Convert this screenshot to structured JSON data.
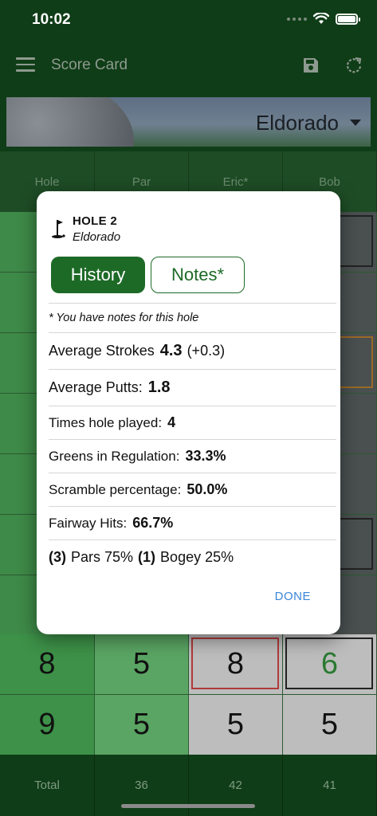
{
  "status_bar": {
    "time": "10:02"
  },
  "app_bar": {
    "title": "Score Card"
  },
  "course": {
    "name": "Eldorado"
  },
  "grid": {
    "headers": [
      "Hole",
      "Par",
      "Eric*",
      "Bob"
    ],
    "rows": [
      {
        "hole": "8",
        "par": "5",
        "eric": "8",
        "bob": "6"
      },
      {
        "hole": "9",
        "par": "5",
        "eric": "5",
        "bob": "5"
      }
    ],
    "totals": {
      "label": "Total",
      "par": "36",
      "eric": "42",
      "bob": "41"
    }
  },
  "dialog": {
    "hole_title": "HOLE 2",
    "course": "Eldorado",
    "tabs": {
      "history": "History",
      "notes": "Notes*"
    },
    "note": "* You have notes for this hole",
    "avg_strokes": {
      "label": "Average Strokes",
      "value": "4.3",
      "delta": "(+0.3)"
    },
    "avg_putts": {
      "label": "Average Putts:",
      "value": "1.8"
    },
    "times_played": {
      "label": "Times hole played:",
      "value": "4"
    },
    "gir": {
      "label": "Greens in Regulation:",
      "value": "33.3%"
    },
    "scramble": {
      "label": "Scramble percentage:",
      "value": "50.0%"
    },
    "fairway": {
      "label": "Fairway Hits:",
      "value": "66.7%"
    },
    "results": {
      "pars_count": "(3)",
      "pars_text": "Pars 75%",
      "bogey_count": "(1)",
      "bogey_text": "Bogey 25%"
    },
    "done": "DONE"
  }
}
